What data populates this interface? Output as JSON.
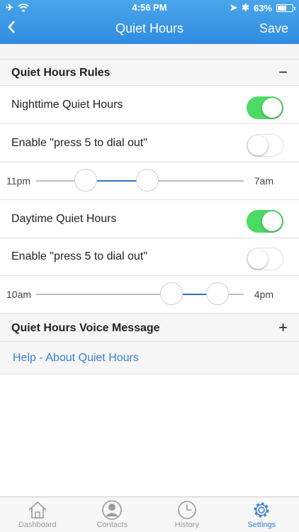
{
  "status_bar": {
    "time": "4:56 PM",
    "battery": "63%",
    "battery_level": 0.63
  },
  "nav": {
    "back_icon": "chevron-left-icon",
    "title": "Quiet Hours",
    "save_label": "Save"
  },
  "rules_section": {
    "title": "Quiet Hours Rules",
    "toggle_sign": "−"
  },
  "nighttime": {
    "label": "Nighttime Quiet Hours",
    "enabled": true,
    "dial_out_label": "Enable \"press 5 to dial out\"",
    "dial_out_enabled": false,
    "start_label": "11pm",
    "end_label": "7am"
  },
  "daytime": {
    "label": "Daytime Quiet Hours",
    "enabled": true,
    "dial_out_label": "Enable \"press 5 to dial out\"",
    "dial_out_enabled": false,
    "start_label": "10am",
    "end_label": "4pm"
  },
  "voice_section": {
    "title": "Quiet Hours Voice Message",
    "toggle_sign": "+"
  },
  "help_link": "Help - About Quiet Hours",
  "tabs": [
    {
      "label": "Dashboard",
      "icon": "home-icon"
    },
    {
      "label": "Contacts",
      "icon": "user-icon"
    },
    {
      "label": "History",
      "icon": "clock-icon"
    },
    {
      "label": "Settings",
      "icon": "gear-icon"
    }
  ],
  "colors": {
    "accent": "#2f8be0",
    "toggle_on": "#4cd964",
    "link": "#3a7fce"
  }
}
